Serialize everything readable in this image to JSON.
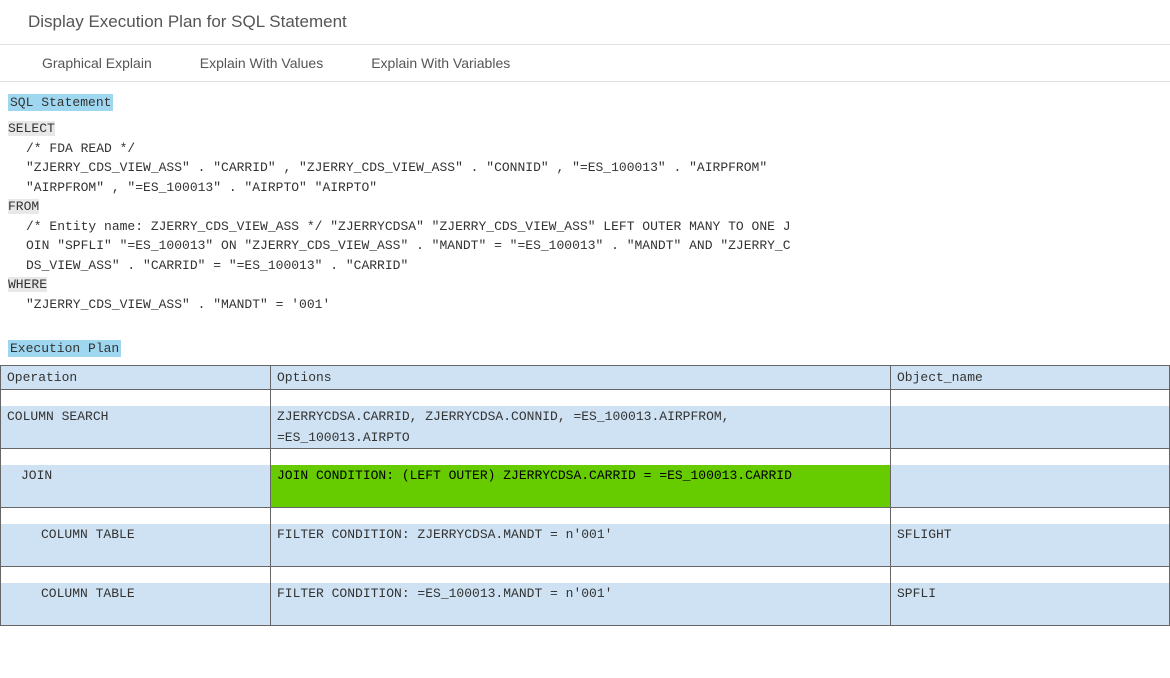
{
  "page_title": "Display Execution Plan for SQL Statement",
  "toolbar": {
    "graphical_explain": "Graphical Explain",
    "explain_with_values": "Explain With Values",
    "explain_with_variables": "Explain With Variables"
  },
  "section_labels": {
    "sql_statement": "SQL Statement",
    "execution_plan": "Execution Plan"
  },
  "sql": {
    "kw_select": "SELECT",
    "line_select_comment": "/* FDA READ */",
    "line_select_cols": "\"ZJERRY_CDS_VIEW_ASS\" . \"CARRID\" , \"ZJERRY_CDS_VIEW_ASS\" . \"CONNID\" , \"=ES_100013\" . \"AIRPFROM\"",
    "line_select_cols2": "\"AIRPFROM\" , \"=ES_100013\" . \"AIRPTO\" \"AIRPTO\"",
    "kw_from": "FROM",
    "line_from1": "/* Entity name: ZJERRY_CDS_VIEW_ASS */ \"ZJERRYCDSA\" \"ZJERRY_CDS_VIEW_ASS\" LEFT OUTER MANY TO ONE J",
    "line_from2": "OIN \"SPFLI\" \"=ES_100013\" ON \"ZJERRY_CDS_VIEW_ASS\" . \"MANDT\" = \"=ES_100013\" . \"MANDT\" AND \"ZJERRY_C",
    "line_from3": "DS_VIEW_ASS\" . \"CARRID\" = \"=ES_100013\" . \"CARRID\"",
    "kw_where": "WHERE",
    "line_where": "\"ZJERRY_CDS_VIEW_ASS\" . \"MANDT\" = '001'"
  },
  "plan": {
    "headers": {
      "operation": "Operation",
      "options": "Options",
      "object_name": "Object_name"
    },
    "rows": [
      {
        "indent": 0,
        "operation": "COLUMN SEARCH",
        "options_line1": "ZJERRYCDSA.CARRID, ZJERRYCDSA.CONNID, =ES_100013.AIRPFROM,",
        "options_line2": "=ES_100013.AIRPTO",
        "object_name": "",
        "highlight": false
      },
      {
        "indent": 1,
        "operation": "JOIN",
        "options_line1": "JOIN CONDITION: (LEFT OUTER) ZJERRYCDSA.CARRID = =ES_100013.CARRID",
        "options_line2": "",
        "object_name": "",
        "highlight": true
      },
      {
        "indent": 2,
        "operation": "COLUMN TABLE",
        "options_line1": "FILTER CONDITION: ZJERRYCDSA.MANDT = n'001'",
        "options_line2": "",
        "object_name": "SFLIGHT",
        "highlight": false
      },
      {
        "indent": 2,
        "operation": "COLUMN TABLE",
        "options_line1": "FILTER CONDITION: =ES_100013.MANDT = n'001'",
        "options_line2": "",
        "object_name": "SPFLI",
        "highlight": false
      }
    ]
  }
}
